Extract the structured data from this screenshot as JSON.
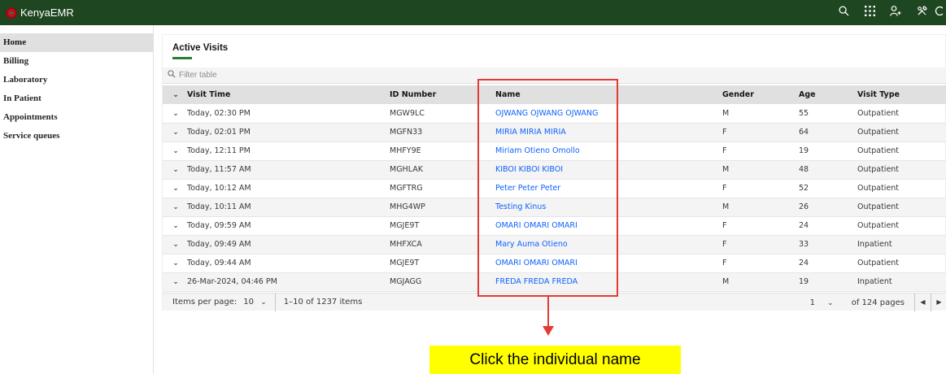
{
  "app": {
    "brand": "KenyaEMR",
    "colors": {
      "header_bg": "#1e4620",
      "accent": "#2e7d32",
      "link": "#0f62fe",
      "annotation": "#e53935",
      "callout_bg": "#ffff00"
    }
  },
  "header_icons": [
    "search-icon",
    "app-grid-icon",
    "user-add-icon",
    "tools-icon",
    "more-icon"
  ],
  "sidebar": {
    "items": [
      {
        "label": "Home",
        "active": true
      },
      {
        "label": "Billing"
      },
      {
        "label": "Laboratory"
      },
      {
        "label": "In Patient"
      },
      {
        "label": "Appointments"
      },
      {
        "label": "Service queues"
      }
    ]
  },
  "card": {
    "title": "Active Visits",
    "filter_placeholder": "Filter table"
  },
  "table": {
    "columns": [
      "Visit Time",
      "ID Number",
      "Name",
      "Gender",
      "Age",
      "Visit Type"
    ],
    "rows": [
      {
        "time": "Today, 02:30 PM",
        "id": "MGW9LC",
        "name": "OJWANG OJWANG OJWANG",
        "gender": "M",
        "age": "55",
        "type": "Outpatient"
      },
      {
        "time": "Today, 02:01 PM",
        "id": "MGFN33",
        "name": "MIRIA MIRIA MIRIA",
        "gender": "F",
        "age": "64",
        "type": "Outpatient"
      },
      {
        "time": "Today, 12:11 PM",
        "id": "MHFY9E",
        "name": "Miriam Otieno Omollo",
        "gender": "F",
        "age": "19",
        "type": "Outpatient"
      },
      {
        "time": "Today, 11:57 AM",
        "id": "MGHLAK",
        "name": "KIBOI KIBOI KIBOI",
        "gender": "M",
        "age": "48",
        "type": "Outpatient"
      },
      {
        "time": "Today, 10:12 AM",
        "id": "MGFTRG",
        "name": "Peter Peter Peter",
        "gender": "F",
        "age": "52",
        "type": "Outpatient"
      },
      {
        "time": "Today, 10:11 AM",
        "id": "MHG4WP",
        "name": "Testing Kinus",
        "gender": "M",
        "age": "26",
        "type": "Outpatient"
      },
      {
        "time": "Today, 09:59 AM",
        "id": "MGJE9T",
        "name": "OMARI OMARI OMARI",
        "gender": "F",
        "age": "24",
        "type": "Outpatient"
      },
      {
        "time": "Today, 09:49 AM",
        "id": "MHFXCA",
        "name": "Mary Auma Otieno",
        "gender": "F",
        "age": "33",
        "type": "Inpatient"
      },
      {
        "time": "Today, 09:44 AM",
        "id": "MGJE9T",
        "name": "OMARI OMARI OMARI",
        "gender": "F",
        "age": "24",
        "type": "Outpatient"
      },
      {
        "time": "26-Mar-2024, 04:46 PM",
        "id": "MGJAGG",
        "name": "FREDA FREDA FREDA",
        "gender": "M",
        "age": "19",
        "type": "Inpatient"
      }
    ]
  },
  "pagination": {
    "items_per_page_label": "Items per page:",
    "items_per_page": "10",
    "range": "1–10 of 1237 items",
    "page": "1",
    "of_pages": "of 124 pages"
  },
  "annotation": {
    "callout": "Click the individual name"
  }
}
